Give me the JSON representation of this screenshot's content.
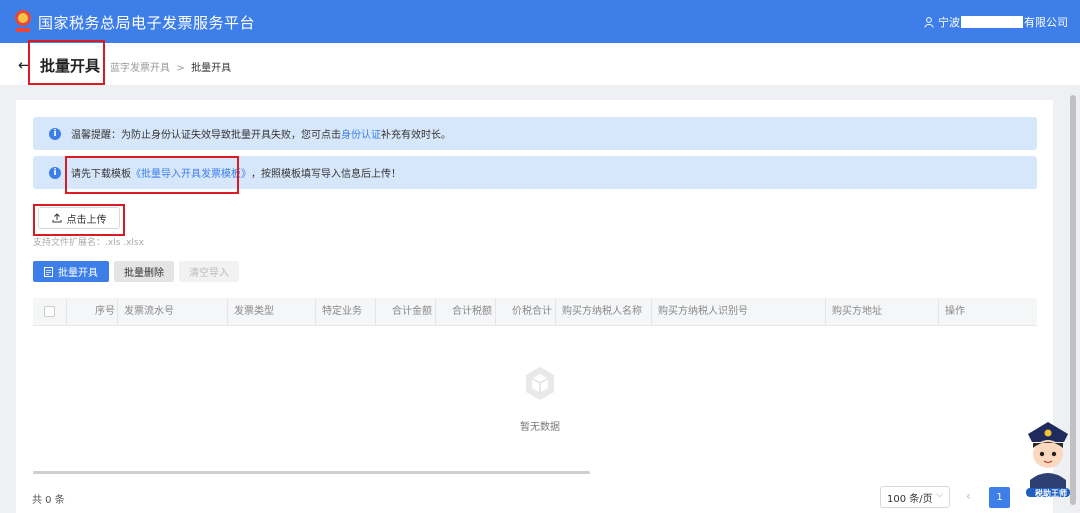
{
  "header": {
    "app_title": "国家税务总局电子发票服务平台",
    "user_prefix": "宁波",
    "user_suffix": "有限公司"
  },
  "subheader": {
    "back_icon": "arrow-left-icon",
    "page_title": "批量开具",
    "breadcrumb": [
      "蓝字发票开具",
      "批量开具"
    ]
  },
  "alerts": {
    "tip_text_before": "温馨提醒：为防止身份认证失效导致批量开具失败，您可点击",
    "tip_link": "身份认证",
    "tip_text_after": "补充有效时长。",
    "template_before": "请先下载模板",
    "template_link": "《批量导入开具发票模板》",
    "template_after": "，按照模板填写导入信息后上传！"
  },
  "upload": {
    "button_label": "点击上传",
    "hint": "支持文件扩展名：.xls .xlsx"
  },
  "actions": {
    "batch_issue": "批量开具",
    "batch_delete": "批量删除",
    "clear_import": "清空导入"
  },
  "table": {
    "columns": [
      "序号",
      "发票流水号",
      "发票类型",
      "特定业务",
      "合计金额",
      "合计税额",
      "价税合计",
      "购买方纳税人名称",
      "购买方纳税人识别号",
      "购买方地址",
      "操作"
    ],
    "empty_text": "暂无数据"
  },
  "pagination": {
    "total": "共 0 条",
    "page_size": "100 条/页",
    "current_page": "1"
  },
  "colors": {
    "primary": "#3d7ee8",
    "alert_bg": "#d7e7fb",
    "highlight": "#d91c24"
  },
  "mascot": {
    "label": "税助王师"
  }
}
